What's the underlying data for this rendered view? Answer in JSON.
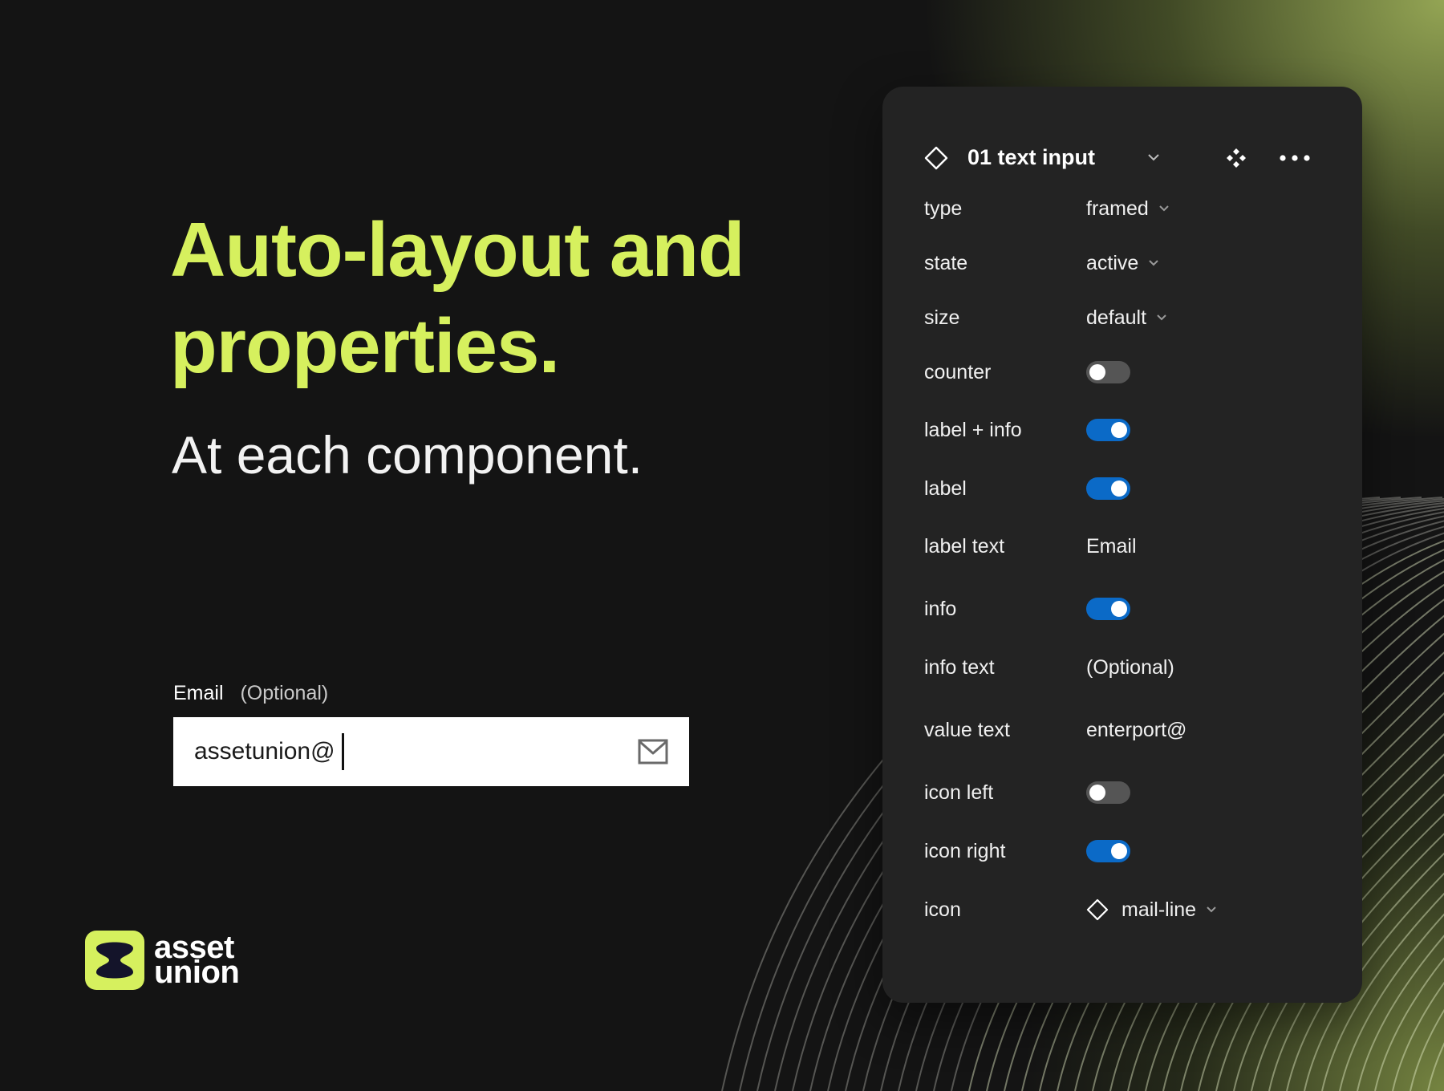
{
  "colors": {
    "accent": "#D6F05E",
    "background": "#141414",
    "panel": "#232323",
    "toggle_on": "#0B6AC7",
    "toggle_off": "#555555"
  },
  "hero": {
    "title": "Auto-layout and properties.",
    "subtitle": "At each component."
  },
  "demo_input": {
    "label": "Email",
    "info": "(Optional)",
    "value": "assetunion@",
    "icon": "mail-icon"
  },
  "logo": {
    "line1": "asset",
    "line2": "union"
  },
  "panel": {
    "component_name": "01 text input",
    "rows": [
      {
        "label": "type",
        "value": "framed",
        "control": "dropdown"
      },
      {
        "label": "state",
        "value": "active",
        "control": "dropdown"
      },
      {
        "label": "size",
        "value": "default",
        "control": "dropdown"
      },
      {
        "label": "counter",
        "control": "toggle",
        "on": false
      },
      {
        "label": "label + info",
        "control": "toggle",
        "on": true
      },
      {
        "label": "label",
        "control": "toggle",
        "on": true
      },
      {
        "label": "label text",
        "value": "Email",
        "control": "text"
      },
      {
        "label": "info",
        "control": "toggle",
        "on": true
      },
      {
        "label": "info text",
        "value": "(Optional)",
        "control": "text"
      },
      {
        "label": "value text",
        "value": "enterport@",
        "control": "text"
      },
      {
        "label": "icon left",
        "control": "toggle",
        "on": false
      },
      {
        "label": "icon right",
        "control": "toggle",
        "on": true
      },
      {
        "label": "icon",
        "value": "mail-line",
        "control": "icon-dropdown"
      }
    ]
  }
}
